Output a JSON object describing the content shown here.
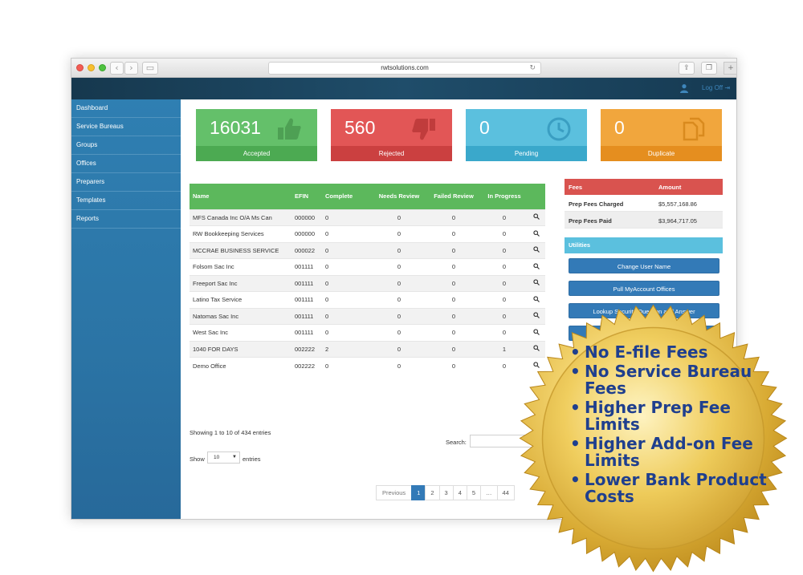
{
  "browser": {
    "url": "rwtsolutions.com"
  },
  "header": {
    "logoff": "Log Off"
  },
  "sidebar": {
    "items": [
      {
        "label": "Dashboard"
      },
      {
        "label": "Service Bureaus"
      },
      {
        "label": "Groups"
      },
      {
        "label": "Offices"
      },
      {
        "label": "Preparers"
      },
      {
        "label": "Templates"
      },
      {
        "label": "Reports"
      }
    ]
  },
  "stats": {
    "accepted": {
      "value": "16031",
      "label": "Accepted",
      "icon": "thumbs-up-icon",
      "color": "#64c06a"
    },
    "rejected": {
      "value": "560",
      "label": "Rejected",
      "icon": "thumbs-down-icon",
      "color": "#e25656"
    },
    "pending": {
      "value": "0",
      "label": "Pending",
      "icon": "clock-icon",
      "color": "#5bc0de"
    },
    "duplicate": {
      "value": "0",
      "label": "Duplicate",
      "icon": "copy-icon",
      "color": "#f1a63d"
    }
  },
  "table": {
    "columns": [
      "Name",
      "EFIN",
      "Complete",
      "Needs Review",
      "Failed Review",
      "In Progress"
    ],
    "rows": [
      {
        "name": "MFS Canada Inc O/A Ms Can",
        "efin": "000000",
        "complete": "0",
        "needs": "0",
        "failed": "0",
        "progress": "0"
      },
      {
        "name": "RW Bookkeeping Services",
        "efin": "000000",
        "complete": "0",
        "needs": "0",
        "failed": "0",
        "progress": "0"
      },
      {
        "name": "MCCRAE BUSINESS SERVICE",
        "efin": "000022",
        "complete": "0",
        "needs": "0",
        "failed": "0",
        "progress": "0"
      },
      {
        "name": "Folsom Sac Inc",
        "efin": "001111",
        "complete": "0",
        "needs": "0",
        "failed": "0",
        "progress": "0"
      },
      {
        "name": "Freeport Sac Inc",
        "efin": "001111",
        "complete": "0",
        "needs": "0",
        "failed": "0",
        "progress": "0"
      },
      {
        "name": "Latino Tax Service",
        "efin": "001111",
        "complete": "0",
        "needs": "0",
        "failed": "0",
        "progress": "0"
      },
      {
        "name": "Natomas Sac Inc",
        "efin": "001111",
        "complete": "0",
        "needs": "0",
        "failed": "0",
        "progress": "0"
      },
      {
        "name": "West Sac Inc",
        "efin": "001111",
        "complete": "0",
        "needs": "0",
        "failed": "0",
        "progress": "0"
      },
      {
        "name": "1040 FOR DAYS",
        "efin": "002222",
        "complete": "2",
        "needs": "0",
        "failed": "0",
        "progress": "1"
      },
      {
        "name": "Demo Office",
        "efin": "002222",
        "complete": "0",
        "needs": "0",
        "failed": "0",
        "progress": "0"
      }
    ],
    "showing": "Showing 1 to 10 of 434 entries",
    "search_label": "Search:",
    "search_value": "",
    "show_label": "Show",
    "show_value": "10",
    "entries_label": "entries"
  },
  "pagination": {
    "previous": "Previous",
    "pages": [
      "1",
      "2",
      "3",
      "4",
      "5",
      "…",
      "44"
    ],
    "active": "1"
  },
  "fees": {
    "header": {
      "label": "Fees",
      "amount": "Amount"
    },
    "rows": [
      {
        "label": "Prep Fees Charged",
        "amount": "$5,557,168.86"
      },
      {
        "label": "Prep Fees Paid",
        "amount": "$3,964,717.05"
      }
    ]
  },
  "utilities": {
    "header": "Utilities",
    "buttons": [
      "Change User Name",
      "Pull MyAccount Offices",
      "Lookup Security Question and Answer"
    ]
  },
  "badge": {
    "color": "#d4a62a",
    "items": [
      "No E-file Fees",
      "No Service Bureau Fees",
      "Higher Prep Fee Limits",
      "Higher Add-on Fee Limits",
      "Lower Bank Product Costs"
    ]
  }
}
